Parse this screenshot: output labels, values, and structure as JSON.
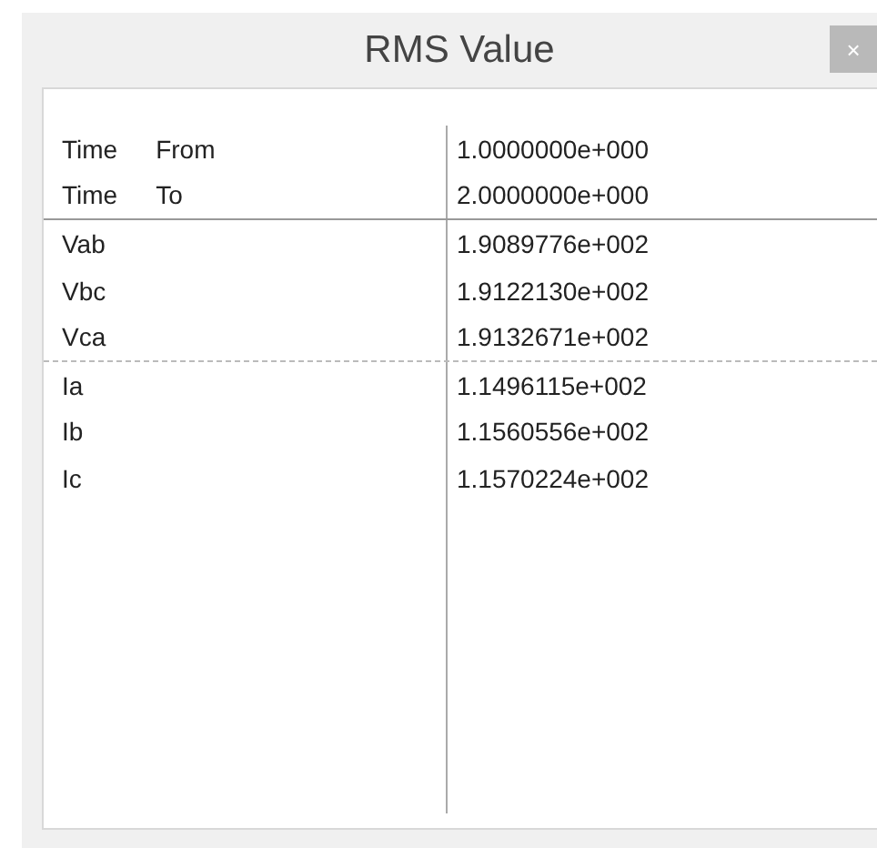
{
  "window": {
    "title": "RMS Value",
    "close": "×"
  },
  "rows": [
    {
      "label": "Time",
      "sublabel": "From",
      "value": "1.0000000e+000",
      "divider_below": false
    },
    {
      "label": "Time",
      "sublabel": "To",
      "value": "2.0000000e+000",
      "divider_below": true,
      "dashed": false
    },
    {
      "label": "Vab",
      "value": "1.9089776e+002",
      "divider_below": false
    },
    {
      "label": "Vbc",
      "value": "1.9122130e+002",
      "divider_below": false
    },
    {
      "label": "Vca",
      "value": "1.9132671e+002",
      "divider_below": true,
      "dashed": true
    },
    {
      "label": "Ia",
      "value": "1.1496115e+002",
      "divider_below": false
    },
    {
      "label": "Ib",
      "value": "1.1560556e+002",
      "divider_below": false
    },
    {
      "label": "Ic",
      "value": "1.1570224e+002",
      "divider_below": false
    }
  ]
}
